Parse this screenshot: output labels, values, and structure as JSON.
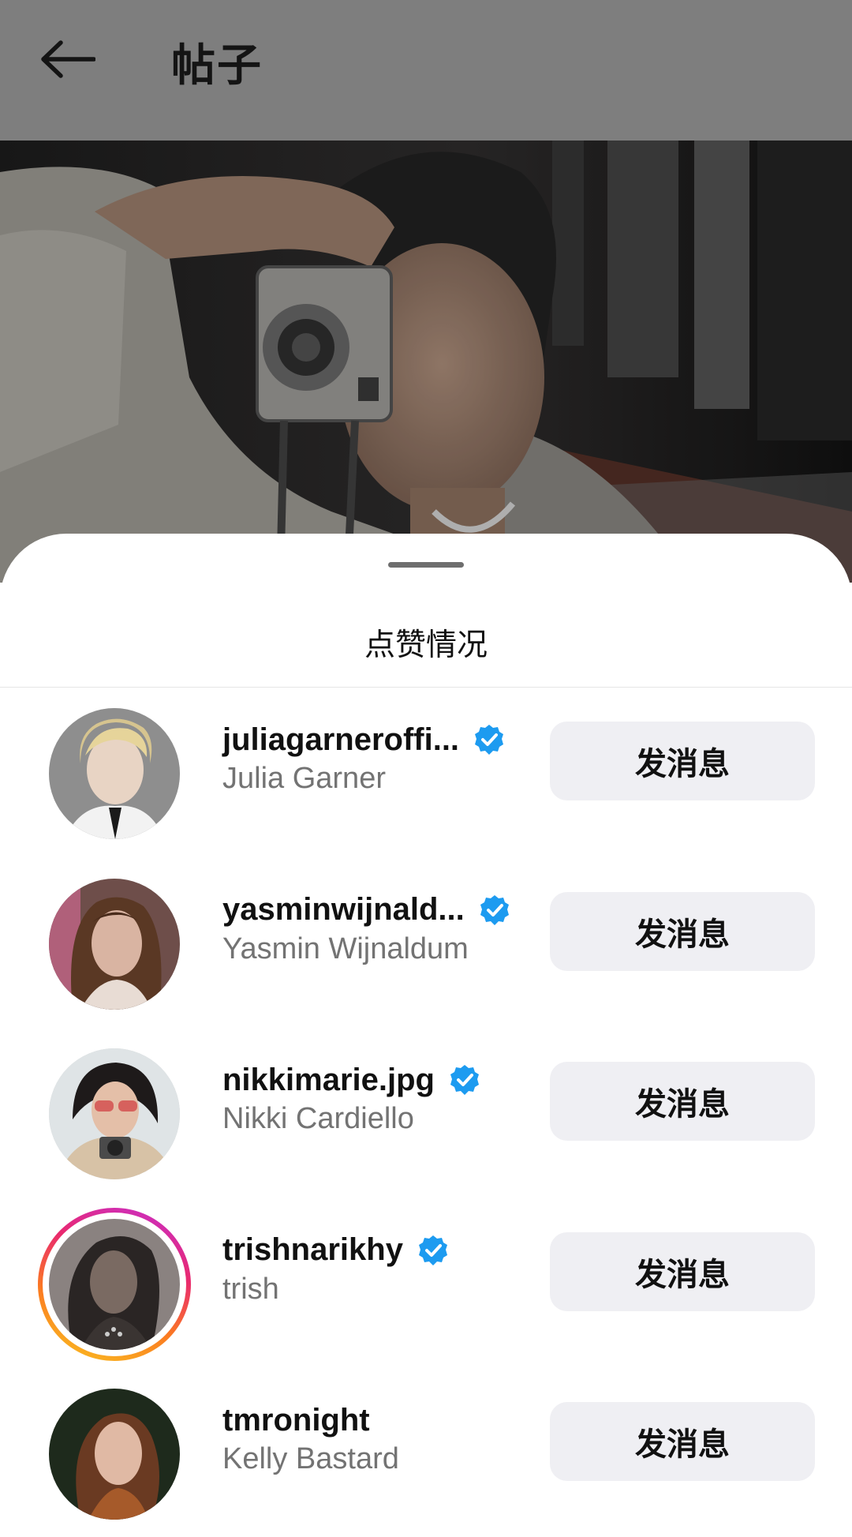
{
  "header": {
    "title": "帖子",
    "back_icon": "arrow-left-icon",
    "background": "#7e7e7e"
  },
  "sheet": {
    "title": "点赞情况"
  },
  "likes": [
    {
      "username": "juliagarneroffi...",
      "fullname": "Julia Garner",
      "verified": true,
      "story_ring": false,
      "button": "发消息"
    },
    {
      "username": "yasminwijnald...",
      "fullname": "Yasmin Wijnaldum",
      "verified": true,
      "story_ring": false,
      "button": "发消息"
    },
    {
      "username": "nikkimarie.jpg",
      "fullname": "Nikki Cardiello",
      "verified": true,
      "story_ring": false,
      "button": "发消息"
    },
    {
      "username": "trishnarikhy",
      "fullname": "trish",
      "verified": true,
      "story_ring": true,
      "button": "发消息"
    },
    {
      "username": "tmronight",
      "fullname": "Kelly Bastard",
      "verified": false,
      "story_ring": false,
      "button": "发消息"
    }
  ],
  "colors": {
    "verified_badge": "#1d9bf0",
    "button_bg": "#efeff3",
    "secondary_text": "#737373"
  }
}
